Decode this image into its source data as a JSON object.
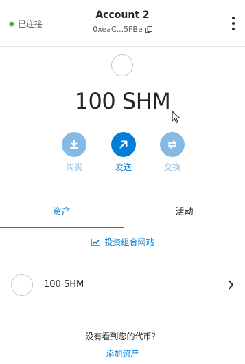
{
  "header": {
    "connection_status": "已连接",
    "account_name": "Account 2",
    "account_address": "0xeaC...5FBe"
  },
  "balance": {
    "amount": "100 SHM"
  },
  "actions": {
    "buy_label": "购买",
    "send_label": "发送",
    "swap_label": "交换"
  },
  "tabs": {
    "assets_label": "资产",
    "activity_label": "活动",
    "active": "assets"
  },
  "portfolio": {
    "label": "投资组合网站"
  },
  "assets": [
    {
      "amount": "100 SHM"
    }
  ],
  "footer": {
    "question": "没有看到您的代币？",
    "add_assets_label": "添加资产"
  },
  "colors": {
    "primary": "#037dd6",
    "primary_disabled": "#85b9e6",
    "connected": "#28a745",
    "text": "#24272a"
  },
  "icons": {
    "buy": "download-icon",
    "send": "arrow-up-right-icon",
    "swap": "swap-icon",
    "menu": "kebab-menu-icon",
    "copy": "copy-icon",
    "portfolio": "chart-icon",
    "asset_row": "chevron-right-icon"
  }
}
